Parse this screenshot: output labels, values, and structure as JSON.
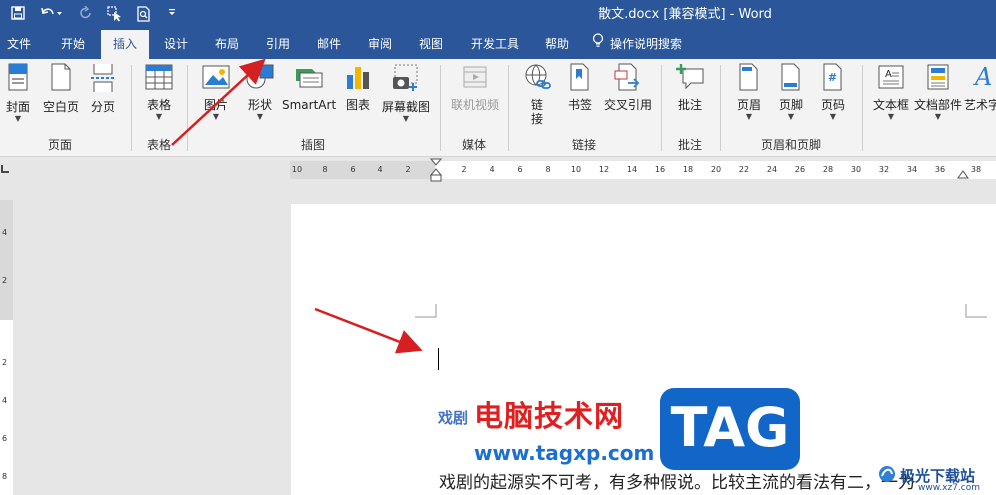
{
  "window": {
    "title": "散文.docx [兼容模式] - Word"
  },
  "tabs": [
    {
      "id": "file",
      "label": "文件"
    },
    {
      "id": "home",
      "label": "开始"
    },
    {
      "id": "insert",
      "label": "插入",
      "active": true
    },
    {
      "id": "design",
      "label": "设计"
    },
    {
      "id": "layout",
      "label": "布局"
    },
    {
      "id": "references",
      "label": "引用"
    },
    {
      "id": "mailings",
      "label": "邮件"
    },
    {
      "id": "review",
      "label": "审阅"
    },
    {
      "id": "view",
      "label": "视图"
    },
    {
      "id": "developer",
      "label": "开发工具"
    },
    {
      "id": "help",
      "label": "帮助"
    },
    {
      "id": "tellme",
      "label": "操作说明搜索"
    }
  ],
  "ribbon": {
    "commands": [
      {
        "id": "cover",
        "label": "封面",
        "dropdown": true
      },
      {
        "id": "blank",
        "label": "空白页"
      },
      {
        "id": "pagebreak",
        "label": "分页"
      },
      {
        "id": "table",
        "label": "表格",
        "dropdown": true
      },
      {
        "id": "pictures",
        "label": "图片",
        "dropdown": true
      },
      {
        "id": "shapes",
        "label": "形状",
        "dropdown": true
      },
      {
        "id": "smartart",
        "label": "SmartArt"
      },
      {
        "id": "chart",
        "label": "图表"
      },
      {
        "id": "screenshot",
        "label": "屏幕截图",
        "dropdown": true
      },
      {
        "id": "onlinevideo",
        "label": "联机视频",
        "disabled": true
      },
      {
        "id": "link",
        "label": "链\n接"
      },
      {
        "id": "bookmark",
        "label": "书签"
      },
      {
        "id": "crossref",
        "label": "交叉引用"
      },
      {
        "id": "comment",
        "label": "批注"
      },
      {
        "id": "header",
        "label": "页眉",
        "dropdown": true
      },
      {
        "id": "footer",
        "label": "页脚",
        "dropdown": true
      },
      {
        "id": "pagenumber",
        "label": "页码",
        "dropdown": true
      },
      {
        "id": "textbox",
        "label": "文本框",
        "dropdown": true
      },
      {
        "id": "quickparts",
        "label": "文档部件",
        "dropdown": true
      },
      {
        "id": "wordart",
        "label": "艺术字"
      }
    ],
    "groups": [
      {
        "id": "pages",
        "label": "页面"
      },
      {
        "id": "tables",
        "label": "表格"
      },
      {
        "id": "illustrations",
        "label": "插图"
      },
      {
        "id": "media",
        "label": "媒体"
      },
      {
        "id": "links",
        "label": "链接"
      },
      {
        "id": "comments",
        "label": "批注"
      },
      {
        "id": "headerfooter",
        "label": "页眉和页脚"
      }
    ]
  },
  "ruler": {
    "left_ticks": [
      "10",
      "8",
      "6",
      "4",
      "2"
    ],
    "right_ticks": [
      "2",
      "4",
      "6",
      "8",
      "10",
      "12",
      "14",
      "16",
      "18",
      "20",
      "22",
      "24",
      "26",
      "28",
      "30",
      "32",
      "34",
      "36",
      "38"
    ]
  },
  "vruler": {
    "ticks": [
      "4",
      "2",
      "2",
      "4",
      "6",
      "8"
    ]
  },
  "document": {
    "heading_fragment": "戏剧",
    "body_line": "戏剧的起源实不可考，有多种假说。比较主流的看法有二，一为"
  },
  "watermark": {
    "title": "电脑技术网",
    "url": "www.tagxp.com",
    "tag": "TAG",
    "site_name": "极光下载站",
    "site_domain": "www.xz7.com"
  },
  "colors": {
    "brand": "#2b579a",
    "annotation_arrow": "#d42020",
    "watermark_red": "#e02020",
    "watermark_blue": "#1266c8"
  }
}
